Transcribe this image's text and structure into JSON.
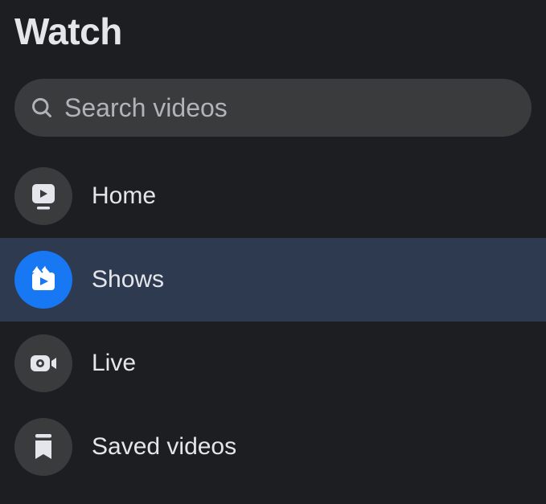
{
  "header": {
    "title": "Watch"
  },
  "search": {
    "placeholder": "Search videos"
  },
  "nav": {
    "items": [
      {
        "label": "Home"
      },
      {
        "label": "Shows"
      },
      {
        "label": "Live"
      },
      {
        "label": "Saved videos"
      }
    ]
  }
}
